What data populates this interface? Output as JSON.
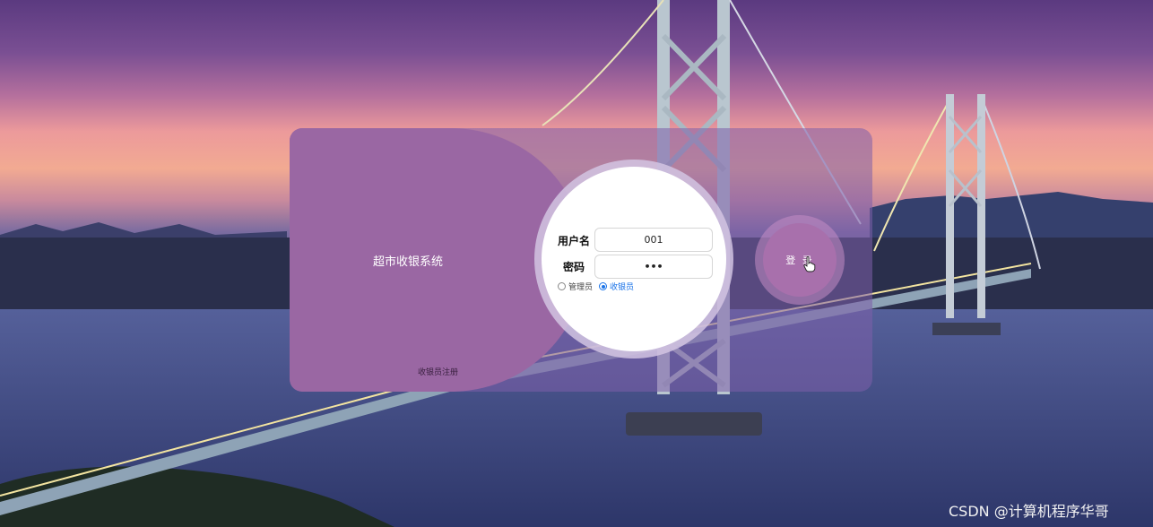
{
  "app": {
    "system_title": "超市收银系统",
    "register_link": "收银员注册"
  },
  "login_form": {
    "username_label": "用户名",
    "username_value": "001",
    "password_label": "密码",
    "password_value": "•••",
    "roles": [
      {
        "label": "管理员",
        "selected": false
      },
      {
        "label": "收银员",
        "selected": true
      }
    ],
    "login_button_label": "登 录"
  },
  "watermark": "CSDN @计算机程序华哥",
  "colors": {
    "card_left": "#9a67a3",
    "login_button": "#a870ac",
    "radio_selected": "#1a73e8"
  },
  "icons": {
    "cursor": "hand-pointer-icon"
  }
}
